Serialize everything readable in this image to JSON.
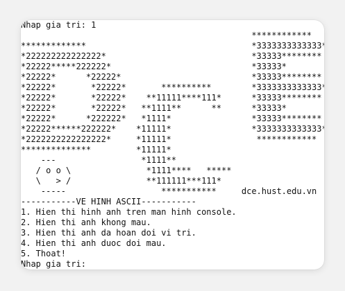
{
  "console": {
    "lines": [
      "Nhap gia tri: 1",
      "                                              ************",
      "*************                                 *3333333333333*",
      "*222222222222222*                             *33333********",
      "*22222*****222222*                            *33333*",
      "*22222*      *22222*                          *33333********",
      "*22222*       *22222*       **********        *3333333333333*",
      "*22222*       *22222*    **11111****111*      *33333********",
      "*22222*       *22222*   **1111**      **      *33333*",
      "*22222*      *222222*   *1111*                *33333********",
      "*22222******222222*    *11111*                *3333333333333*",
      "*2222222222222222*     *11111*                 ************",
      "**************         *11111*",
      "    ---                 *1111**",
      "   / o o \\               *1111****   *****",
      "   \\   > /               **111111***111*",
      "    -----                   ***********     dce.hust.edu.vn",
      "-----------VE HINH ASCII-----------",
      "1. Hien thi hinh anh tren man hinh console.",
      "2. Hien thi anh khong mau.",
      "3. Hien thi anh da hoan doi vi tri.",
      "4. Hien thi anh duoc doi mau.",
      "5. Thoat!",
      "Nhap gia tri:"
    ]
  }
}
